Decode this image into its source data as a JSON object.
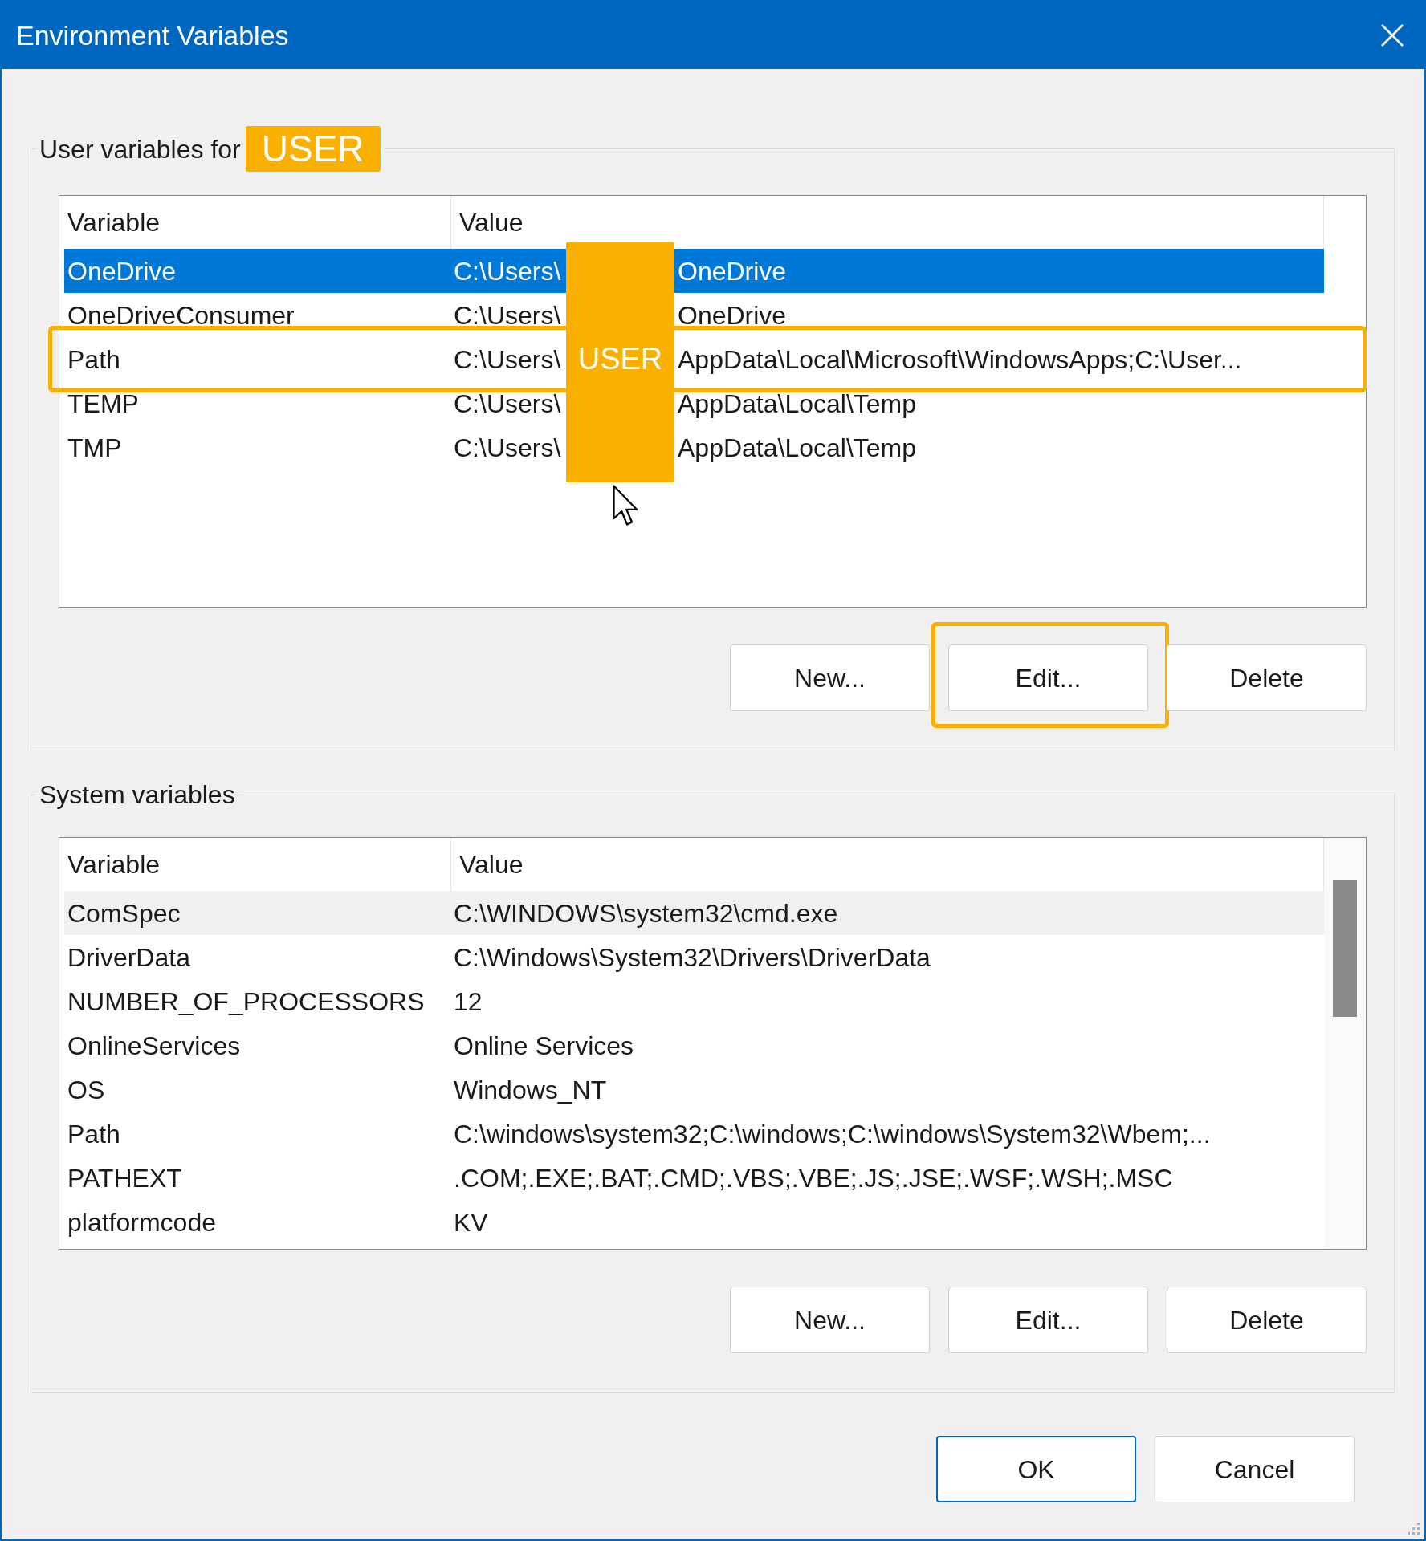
{
  "window": {
    "title": "Environment Variables"
  },
  "user_variables": {
    "label": "User variables for",
    "user_badge": "USER",
    "table": {
      "columns": [
        "Variable",
        "Value"
      ],
      "focused": true,
      "rows": [
        {
          "variable": "OneDrive",
          "value_start": "C:\\Users\\",
          "value_end": "OneDrive",
          "selected": true,
          "highlighted": false
        },
        {
          "variable": "OneDriveConsumer",
          "value_start": "C:\\Users\\",
          "value_end": "OneDrive",
          "selected": false,
          "highlighted": false
        },
        {
          "variable": "Path",
          "value_start": "C:\\Users\\",
          "value_end": "AppData\\Local\\Microsoft\\WindowsApps;C:\\User...",
          "redaction_label": "USER",
          "selected": false,
          "highlighted": true
        },
        {
          "variable": "TEMP",
          "value_start": "C:\\Users\\",
          "value_end": "AppData\\Local\\Temp",
          "selected": false,
          "highlighted": false
        },
        {
          "variable": "TMP",
          "value_start": "C:\\Users\\",
          "value_end": "AppData\\Local\\Temp",
          "selected": false,
          "highlighted": false
        }
      ]
    },
    "buttons": [
      {
        "label": "New...",
        "highlighted": false
      },
      {
        "label": "Edit...",
        "highlighted": true
      },
      {
        "label": "Delete",
        "highlighted": false
      }
    ]
  },
  "system_variables": {
    "label": "System variables",
    "table": {
      "columns": [
        "Variable",
        "Value"
      ],
      "focused": false,
      "rows": [
        {
          "variable": "ComSpec",
          "value": "C:\\WINDOWS\\system32\\cmd.exe",
          "selected": true
        },
        {
          "variable": "DriverData",
          "value": "C:\\Windows\\System32\\Drivers\\DriverData",
          "selected": false
        },
        {
          "variable": "NUMBER_OF_PROCESSORS",
          "value": "12",
          "selected": false
        },
        {
          "variable": "OnlineServices",
          "value": "Online Services",
          "selected": false
        },
        {
          "variable": "OS",
          "value": "Windows_NT",
          "selected": false
        },
        {
          "variable": "Path",
          "value": "C:\\windows\\system32;C:\\windows;C:\\windows\\System32\\Wbem;...",
          "selected": false
        },
        {
          "variable": "PATHEXT",
          "value": ".COM;.EXE;.BAT;.CMD;.VBS;.VBE;.JS;.JSE;.WSF;.WSH;.MSC",
          "selected": false
        },
        {
          "variable": "platformcode",
          "value": "KV",
          "selected": false
        }
      ]
    },
    "buttons": [
      {
        "label": "New...",
        "highlighted": false
      },
      {
        "label": "Edit...",
        "highlighted": false
      },
      {
        "label": "Delete",
        "highlighted": false
      }
    ]
  },
  "dialog_buttons": [
    {
      "label": "OK",
      "default": true
    },
    {
      "label": "Cancel",
      "default": false
    }
  ]
}
